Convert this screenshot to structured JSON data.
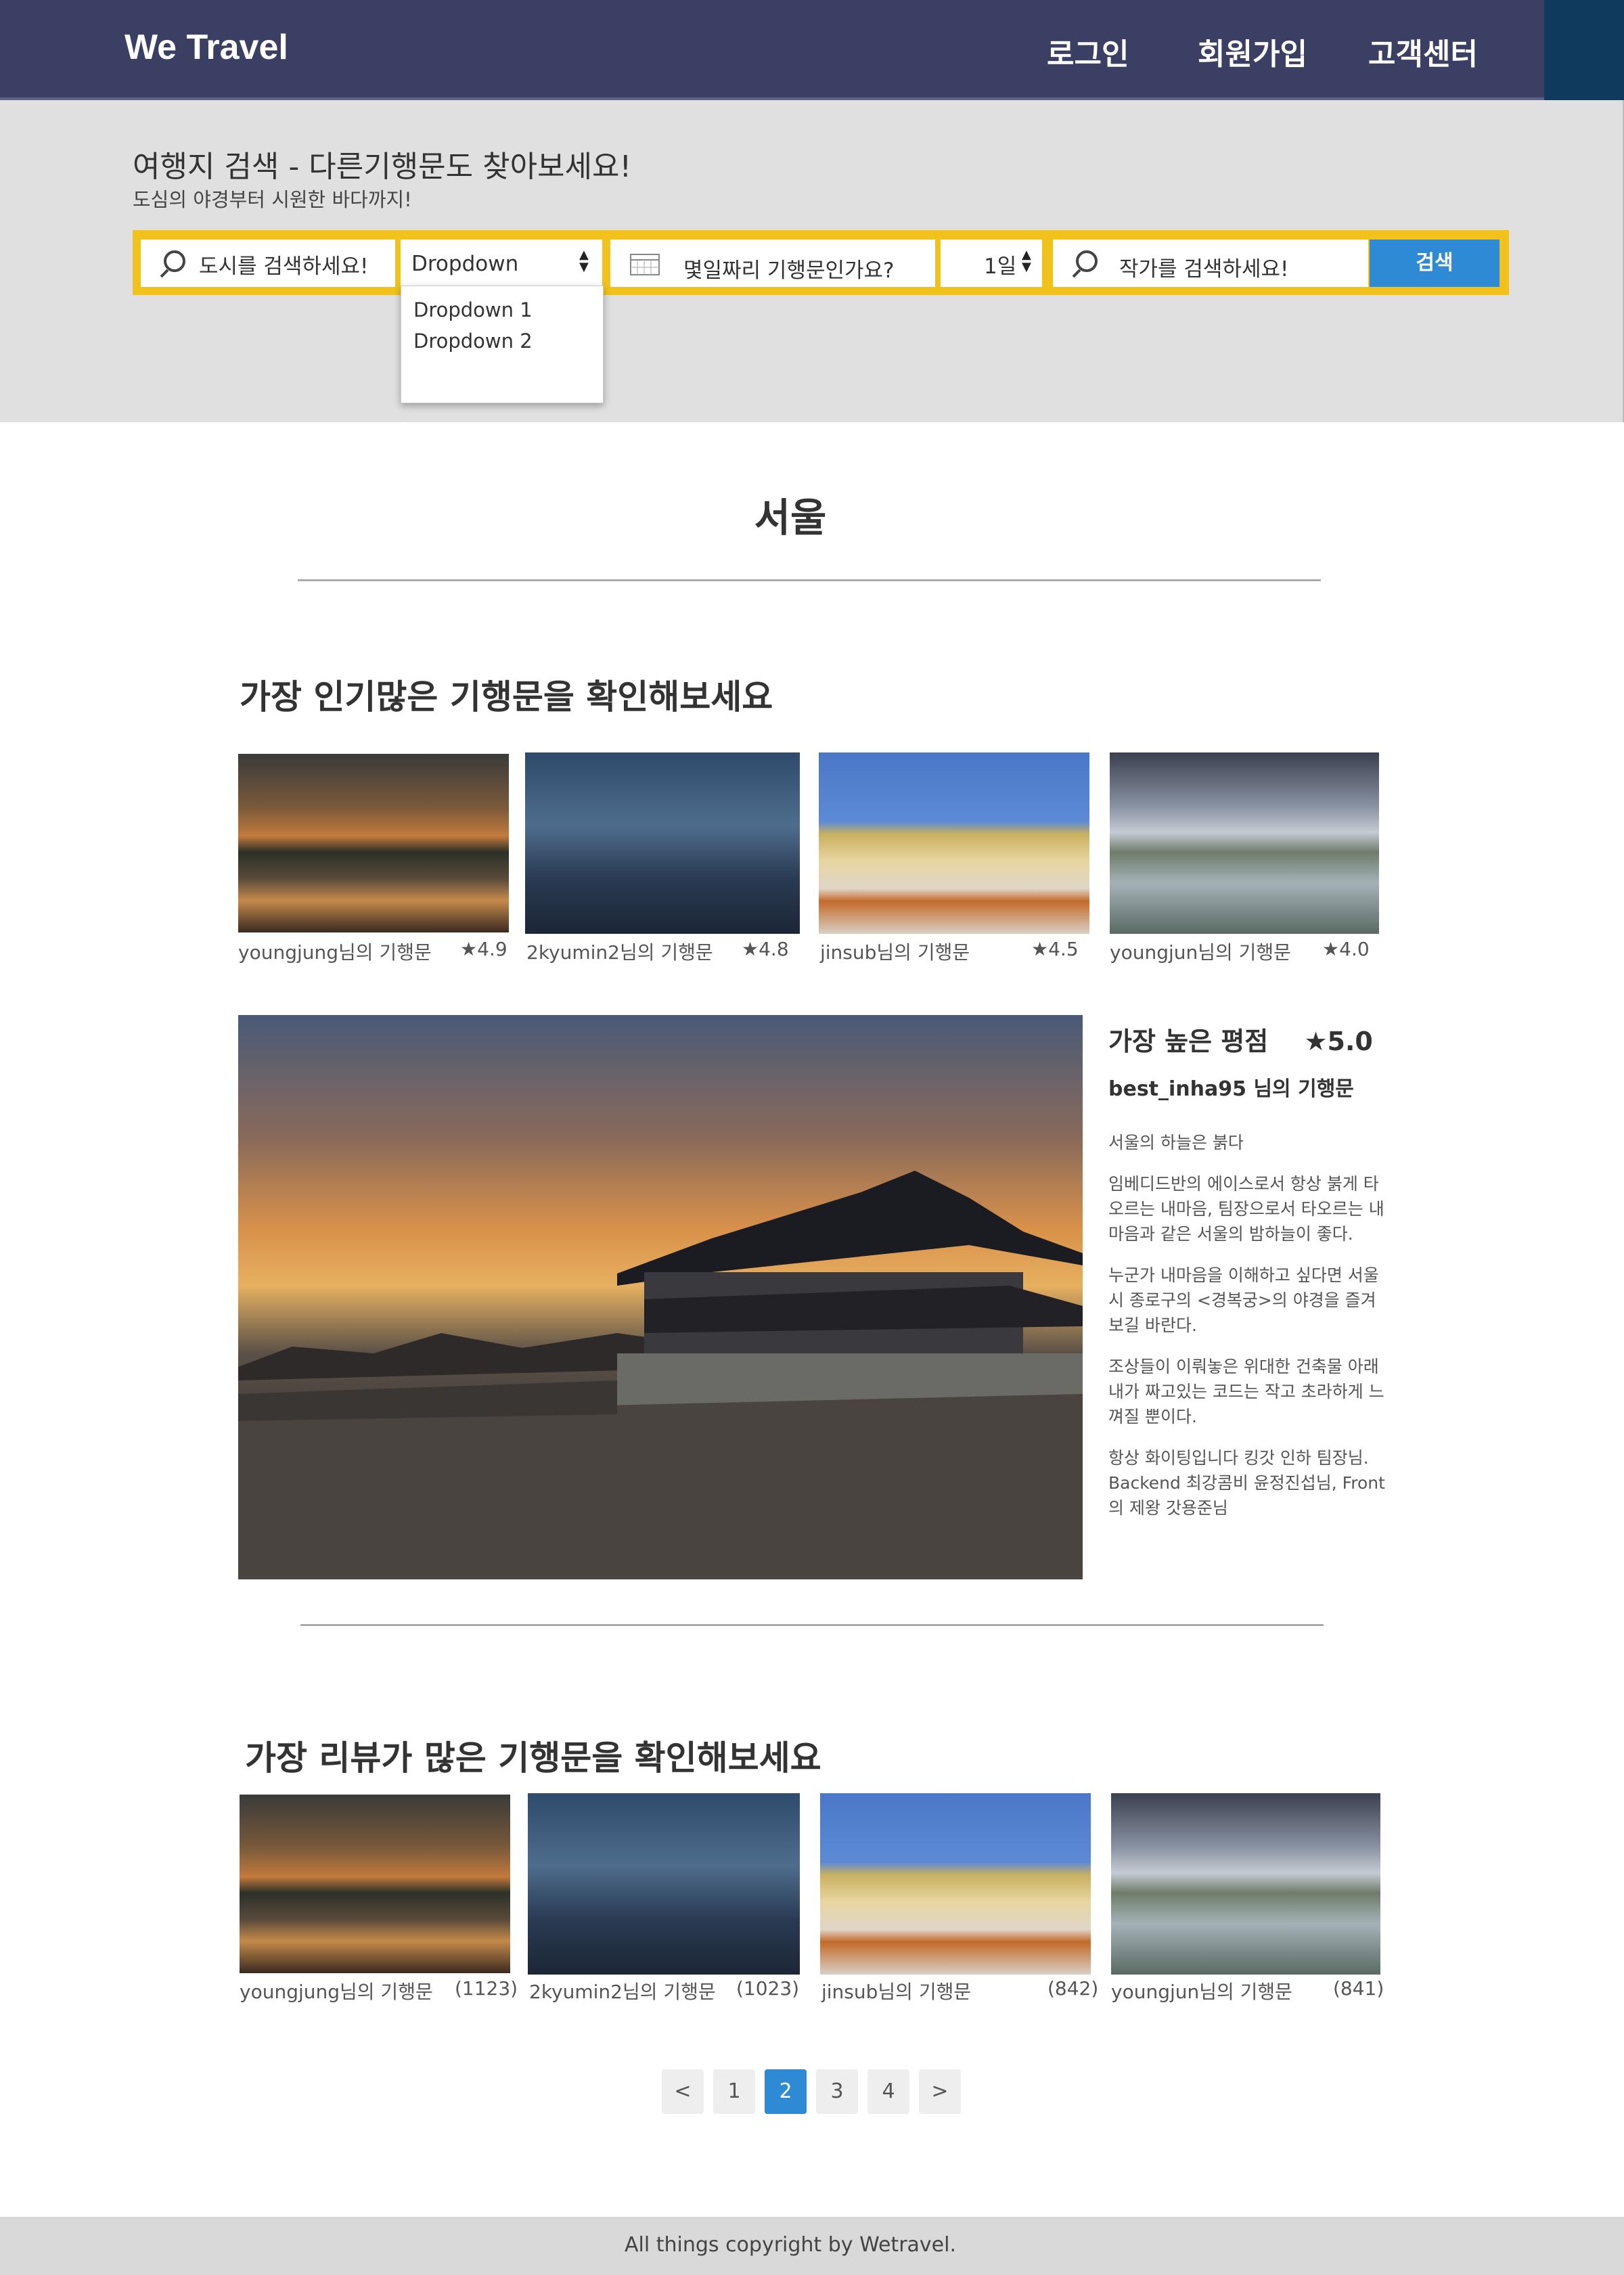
{
  "header": {
    "logo": "We Travel",
    "nav": [
      "로그인",
      "회원가입",
      "고객센터"
    ]
  },
  "search": {
    "title": "여행지 검색 - 다른기행문도 찾아보세요!",
    "subtitle": "도심의 야경부터 시원한 바다까지!",
    "city_placeholder": "도시를 검색하세요!",
    "dropdown_value": "Dropdown",
    "dropdown_options": [
      "Dropdown 1",
      "Dropdown 2"
    ],
    "days_placeholder": "몇일짜리 기행문인가요?",
    "days_value": "1일",
    "author_placeholder": "작가를 검색하세요!",
    "search_button": "검색"
  },
  "city": "서울",
  "popular": {
    "title": "가장 인기많은 기행문을 확인해보세요",
    "items": [
      {
        "author": "youngjung님의 기행문",
        "rating": "★4.9"
      },
      {
        "author": "2kyumin2님의 기행문",
        "rating": "★4.8"
      },
      {
        "author": "jinsub님의 기행문",
        "rating": "★4.5"
      },
      {
        "author": "youngjun님의 기행문",
        "rating": "★4.0"
      }
    ]
  },
  "best": {
    "heading": "가장 높은 평점",
    "rating": "★5.0",
    "author": "best_inha95 님의 기행문",
    "paragraphs": [
      "서울의 하늘은 붉다",
      "임베디드반의 에이스로서 항상 붉게 타오르는 내마음, 팀장으로서 타오르는 내마음과 같은 서울의 밤하늘이 좋다.",
      "누군가 내마음을 이해하고 싶다면 서울시 종로구의 <경복궁>의 야경을 즐겨보길 바란다.",
      "조상들이 이뤄놓은 위대한 건축물 아래 내가 짜고있는 코드는 작고 초라하게 느껴질 뿐이다.",
      "항상 화이팅입니다 킹갓 인하 팀장님. Backend 최강콤비 윤정진섭님, Front의 제왕 갓용준님"
    ]
  },
  "reviews": {
    "title": "가장 리뷰가 많은 기행문을 확인해보세요",
    "items": [
      {
        "author": "youngjung님의 기행문",
        "count": "(1123)"
      },
      {
        "author": "2kyumin2님의 기행문",
        "count": "(1023)"
      },
      {
        "author": "jinsub님의 기행문",
        "count": "(842)"
      },
      {
        "author": "youngjun님의 기행문",
        "count": "(841)"
      }
    ]
  },
  "pagination": {
    "prev": "<",
    "pages": [
      "1",
      "2",
      "3",
      "4"
    ],
    "next": ">",
    "current": "2"
  },
  "footer": "All things copyright by Wetravel.",
  "colors": {
    "header_bg": "#3b3f63",
    "accent_yellow": "#f1c21b",
    "accent_blue": "#2f8ad6"
  }
}
